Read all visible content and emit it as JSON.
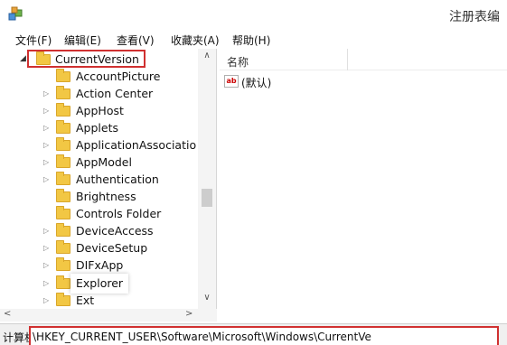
{
  "window": {
    "title": "注册表编",
    "icon": "registry-app-icon"
  },
  "menu": [
    {
      "label": "文件(F)"
    },
    {
      "label": "编辑(E)"
    },
    {
      "label": "查看(V)"
    },
    {
      "label": "收藏夹(A)"
    },
    {
      "label": "帮助(H)"
    }
  ],
  "tree": {
    "selected": "CurrentVersion",
    "children": [
      {
        "label": "AccountPicture"
      },
      {
        "label": "Action Center"
      },
      {
        "label": "AppHost"
      },
      {
        "label": "Applets"
      },
      {
        "label": "ApplicationAssociatio"
      },
      {
        "label": "AppModel"
      },
      {
        "label": "Authentication"
      },
      {
        "label": "Brightness"
      },
      {
        "label": "Controls Folder"
      },
      {
        "label": "DeviceAccess"
      },
      {
        "label": "DeviceSetup"
      },
      {
        "label": "DIFxApp"
      },
      {
        "label": "Explorer"
      },
      {
        "label": "Ext"
      }
    ]
  },
  "values_pane": {
    "column_name": "名称",
    "rows": [
      {
        "icon": "string-value-icon",
        "icon_text": "ab",
        "name": "(默认)"
      }
    ]
  },
  "status_bar": {
    "prefix": "计算机",
    "path": "\\HKEY_CURRENT_USER\\Software\\Microsoft\\Windows\\CurrentVe"
  },
  "colors": {
    "highlight_border": "#d03030",
    "folder": "#f2c744"
  }
}
